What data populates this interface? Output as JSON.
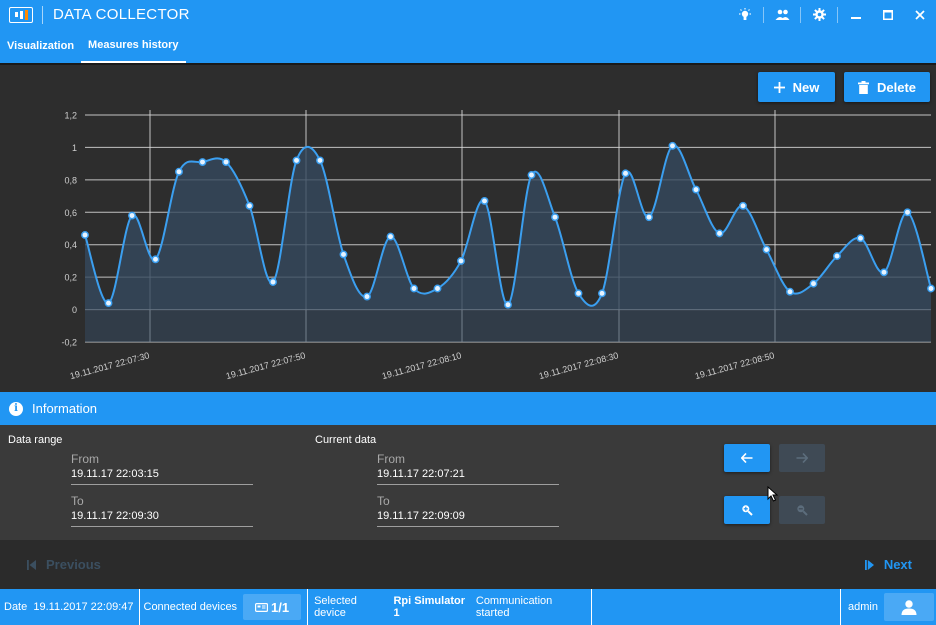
{
  "app": {
    "title": "DATA COLLECTOR"
  },
  "tabs": [
    {
      "label": "Visualization"
    },
    {
      "label": "Measures history"
    }
  ],
  "toolbar": {
    "new_label": "New",
    "delete_label": "Delete"
  },
  "chart_data": {
    "type": "area",
    "x_labels": [
      "19.11.2017 22:07:30",
      "19.11.2017 22:07:50",
      "19.11.2017 22:08:10",
      "19.11.2017 22:08:30",
      "19.11.2017 22:08:50"
    ],
    "y_ticks": [
      "1,2",
      "1",
      "0,8",
      "0,6",
      "0,4",
      "0,2",
      "0",
      "-0,2"
    ],
    "ylim": [
      -0.2,
      1.2
    ],
    "grid": true,
    "line_color": "#3b9ff0",
    "fill_color": "#35495e",
    "values": [
      0.46,
      0.04,
      0.58,
      0.31,
      0.85,
      0.91,
      0.91,
      0.64,
      0.17,
      0.92,
      0.92,
      0.34,
      0.08,
      0.45,
      0.13,
      0.13,
      0.3,
      0.67,
      0.03,
      0.83,
      0.57,
      0.1,
      0.1,
      0.84,
      0.57,
      1.01,
      0.74,
      0.47,
      0.64,
      0.37,
      0.11,
      0.16,
      0.33,
      0.44,
      0.23,
      0.6,
      0.13
    ]
  },
  "information": {
    "title": "Information",
    "data_range": {
      "title": "Data range",
      "from_label": "From",
      "from_value": "19.11.17 22:03:15",
      "to_label": "To",
      "to_value": "19.11.17 22:09:30"
    },
    "current_data": {
      "title": "Current data",
      "from_label": "From",
      "from_value": "19.11.17 22:07:21",
      "to_label": "To",
      "to_value": "19.11.17 22:09:09"
    }
  },
  "pager": {
    "previous_label": "Previous",
    "next_label": "Next"
  },
  "status": {
    "date_label": "Date",
    "date_value": "19.11.2017 22:09:47",
    "connected_label": "Connected devices",
    "connected_count": "1/1",
    "selected_label": "Selected device",
    "selected_device": "Rpi Simulator 1",
    "selected_status": "Communication started",
    "user": "admin"
  },
  "colors": {
    "accent": "#2196f3",
    "disabled": "#3f4a55"
  }
}
